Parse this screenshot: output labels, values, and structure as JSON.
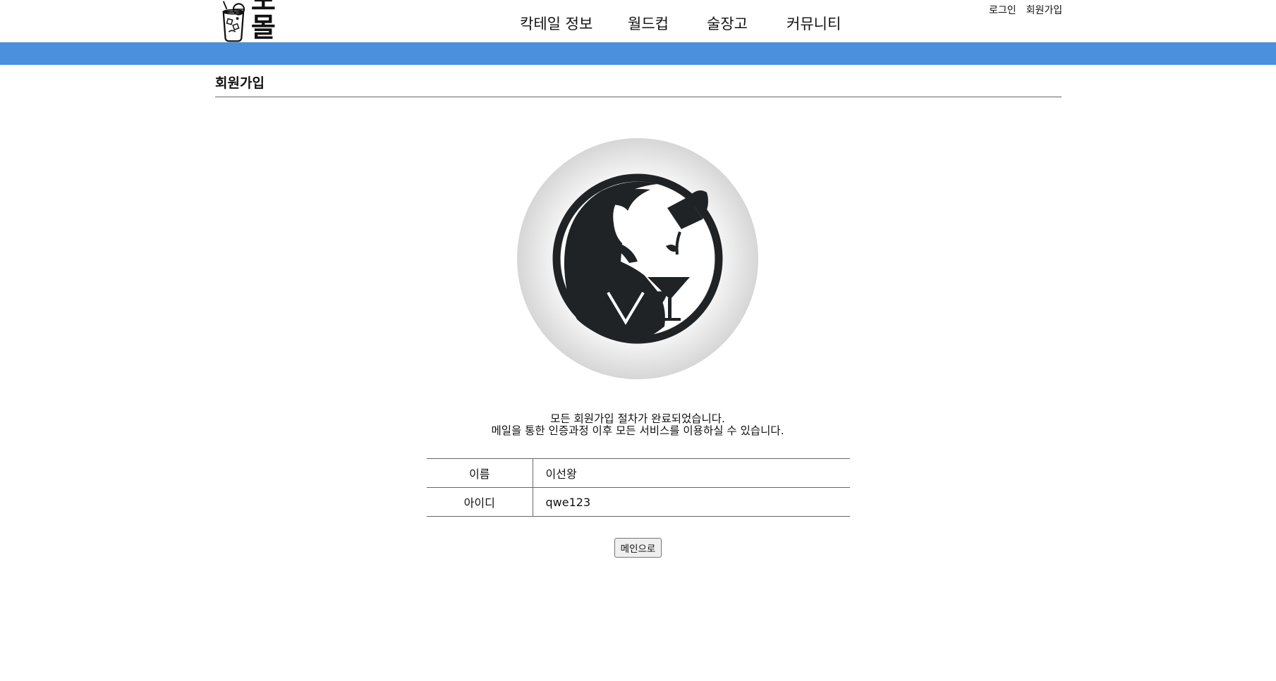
{
  "brand": {
    "name": "모몰"
  },
  "nav": {
    "items": [
      {
        "label": "칵테일 정보"
      },
      {
        "label": "월드컵"
      },
      {
        "label": "술장고"
      },
      {
        "label": "커뮤니티"
      }
    ]
  },
  "user_links": {
    "login": "로그인",
    "signup": "회원가입"
  },
  "page": {
    "title": "회원가입",
    "message_line1": "모든 회원가입 절차가 완료되었습니다.",
    "message_line2": "메일을 통한 인증과정 이후 모든 서비스를 이용하실 수 있습니다."
  },
  "info_table": {
    "rows": [
      {
        "key": "이름",
        "value": "이선왕"
      },
      {
        "key": "아이디",
        "value": "qwe123"
      }
    ]
  },
  "buttons": {
    "main": "메인으로"
  },
  "colors": {
    "accent_bar": "#4a90dd",
    "rule": "#666666"
  },
  "icons": {
    "logo": "cocktail-glass-icon",
    "hero": "bartender-illustration"
  }
}
